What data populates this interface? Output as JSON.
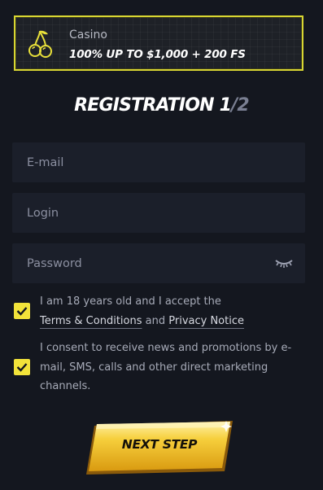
{
  "promo": {
    "category": "Casino",
    "offer": "100% UP TO $1,000 + 200 FS",
    "icon": "cherries-icon",
    "accent_color": "#d8d632"
  },
  "registration": {
    "title": "REGISTRATION 1",
    "separator": "/",
    "step_total": "2"
  },
  "form": {
    "email_placeholder": "E-mail",
    "login_placeholder": "Login",
    "password_placeholder": "Password",
    "password_toggle_icon": "eye-closed-icon"
  },
  "consents": [
    {
      "checked": true,
      "text_before": "I am 18 years old and I accept the",
      "link1": "Terms & Conditions",
      "joiner": "and",
      "link2": "Privacy Notice"
    },
    {
      "checked": true,
      "text": "I consent to receive news and promotions by e-mail, SMS, calls and other direct marketing channels."
    }
  ],
  "cta": {
    "label": "NEXT STEP",
    "color": "#f2c230"
  },
  "colors": {
    "background": "#14171f",
    "field": "#1b1f2a",
    "checkbox": "#f2e33a"
  }
}
